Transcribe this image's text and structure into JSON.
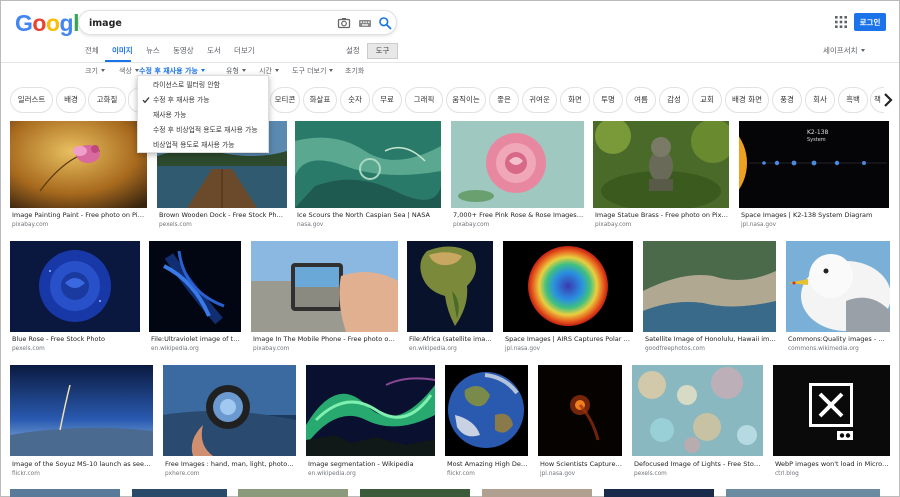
{
  "logo": {
    "letters": [
      "G",
      "o",
      "o",
      "g",
      "l",
      "e"
    ],
    "colors": [
      "#4285f4",
      "#ea4335",
      "#fbbc05",
      "#4285f4",
      "#34a853",
      "#ea4335"
    ]
  },
  "search": {
    "query": "image"
  },
  "header": {
    "login_label": "로그인"
  },
  "tabs": [
    {
      "label": "전체",
      "active": false
    },
    {
      "label": "이미지",
      "active": true
    },
    {
      "label": "뉴스",
      "active": false
    },
    {
      "label": "동영상",
      "active": false
    },
    {
      "label": "도서",
      "active": false
    },
    {
      "label": "더보기",
      "active": false
    }
  ],
  "settings_label": "설정",
  "tools_label": "도구",
  "safesearch_label": "세이프서치",
  "filters": [
    {
      "label": "크기",
      "caret": true,
      "active": false
    },
    {
      "label": "색상",
      "caret": true,
      "active": false
    },
    {
      "label": "수정 후 재사용 가능",
      "caret": true,
      "active": true
    },
    {
      "label": "유형",
      "caret": true,
      "active": false
    },
    {
      "label": "시간",
      "caret": true,
      "active": false
    },
    {
      "label": "도구 더보기",
      "caret": true,
      "active": false
    },
    {
      "label": "초기화",
      "caret": false,
      "active": false
    }
  ],
  "dropdown": [
    {
      "label": "라이선스로 필터링 안함",
      "checked": false
    },
    {
      "label": "수정 후 재사용 가능",
      "checked": true
    },
    {
      "label": "재사용 가능",
      "checked": false
    },
    {
      "label": "수정 후 비상업적 용도로 재사용 가능",
      "checked": false
    },
    {
      "label": "비상업적 용도로 재사용 가능",
      "checked": false
    }
  ],
  "chips": [
    "일러스트",
    "배경",
    "고화질",
    "",
    "",
    "",
    "",
    "",
    "",
    "모티콘",
    "화살표",
    "숫자",
    "무료",
    "그래픽",
    "움직이는",
    "좋은",
    "귀여운",
    "화면",
    "투명",
    "여름",
    "감성",
    "교회",
    "배경 화면",
    "풍경",
    "회사",
    "흑백",
    "책"
  ],
  "images": [
    [
      {
        "caption": "Image Painting Paint - Free photo on Pixabay",
        "source": "pixabay.com",
        "art": "flower-paint"
      },
      {
        "caption": "Brown Wooden Dock - Free Stock Photo",
        "source": "pexels.com",
        "art": "dock"
      },
      {
        "caption": "Ice Scours the North Caspian Sea | NASA",
        "source": "nasa.gov",
        "art": "caspian"
      },
      {
        "caption": "7,000+ Free Pink Rose & Rose Images - Pixabay",
        "source": "pixabay.com",
        "art": "pink-rose"
      },
      {
        "caption": "Image Statue Brass - Free photo on Pixabay",
        "source": "pixabay.com",
        "art": "statue"
      },
      {
        "caption": "Space Images | K2-138 System Diagram",
        "source": "jpl.nasa.gov",
        "art": "k2"
      }
    ],
    [
      {
        "caption": "Blue Rose - Free Stock Photo",
        "source": "pexels.com",
        "art": "blue-rose"
      },
      {
        "caption": "File:Ultraviolet image of the Cy...",
        "source": "en.wikipedia.org",
        "art": "uv"
      },
      {
        "caption": "Image In The Mobile Phone - Free photo on Pixabay",
        "source": "pixabay.com",
        "art": "phone"
      },
      {
        "caption": "File:Africa (satellite image).j...",
        "source": "en.wikipedia.org",
        "art": "africa"
      },
      {
        "caption": "Space Images | AIRS Captures Polar Vortex",
        "source": "jpl.nasa.gov",
        "art": "vortex"
      },
      {
        "caption": "Satellite Image of Honolulu, Hawaii image - Fr...",
        "source": "goodfreephotos.com",
        "art": "honolulu"
      },
      {
        "caption": "Commons:Quality images - Wikimed...",
        "source": "commons.wikimedia.org",
        "art": "gull"
      }
    ],
    [
      {
        "caption": "Image of the Soyuz MS-10 launch as seen from th...",
        "source": "flickr.com",
        "art": "soyuz"
      },
      {
        "caption": "Free Images : hand, man, light, photographer, ...",
        "source": "pxhere.com",
        "art": "lens"
      },
      {
        "caption": "Image segmentation - Wikipedia",
        "source": "en.wikipedia.org",
        "art": "aurora"
      },
      {
        "caption": "Most Amazing High Definiti...",
        "source": "flickr.com",
        "art": "earth"
      },
      {
        "caption": "How Scientists Captured the ...",
        "source": "jpl.nasa.gov",
        "art": "comet"
      },
      {
        "caption": "Defocused Image of Lights - Free Stock Photo",
        "source": "pexels.com",
        "art": "bokeh"
      },
      {
        "caption": "WebP images won't load in Microsoft Ed...",
        "source": "ctrl.blog",
        "art": "broken"
      }
    ]
  ]
}
